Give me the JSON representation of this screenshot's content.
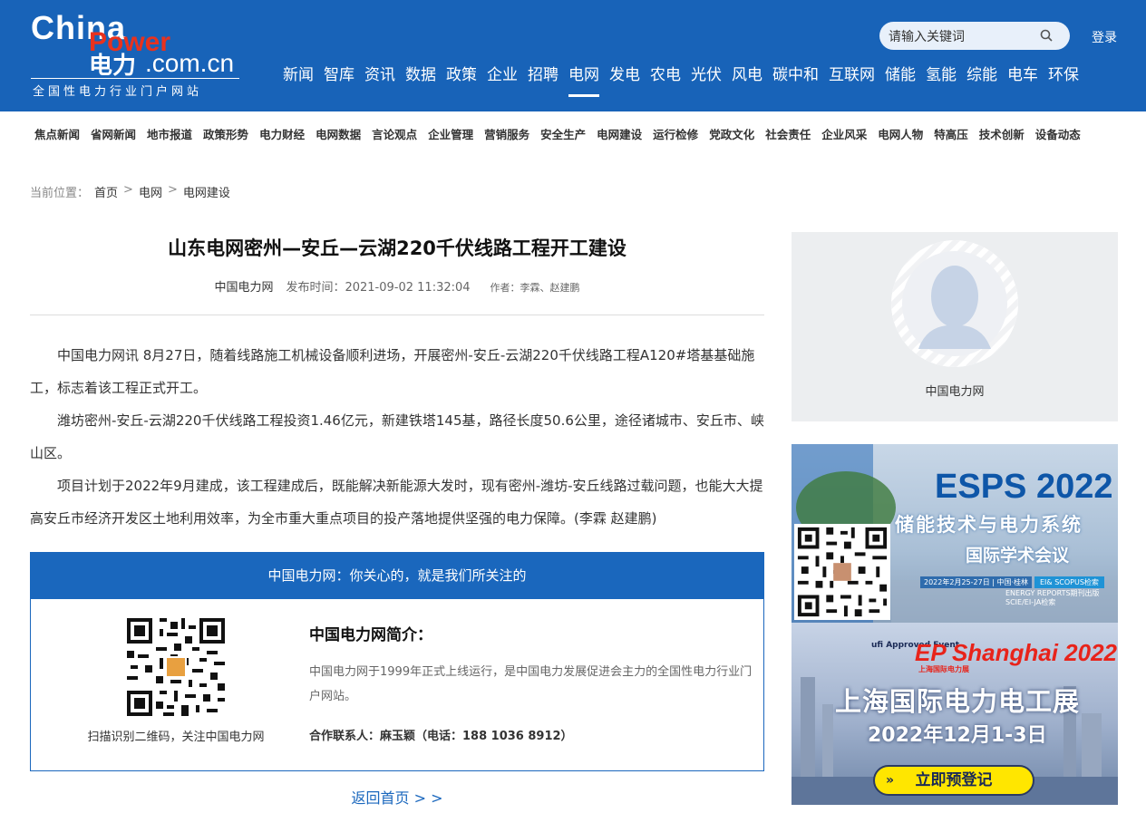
{
  "header": {
    "logo_china": "China",
    "logo_power": "Power",
    "logo_dian": "电力",
    "logo_domain": ".com.cn",
    "logo_sub": "全国性电力行业门户网站",
    "nav": [
      "新闻",
      "智库",
      "资讯",
      "数据",
      "政策",
      "企业",
      "招聘",
      "电网",
      "发电",
      "农电",
      "光伏",
      "风电",
      "碳中和",
      "互联网",
      "储能",
      "氢能",
      "综能",
      "电车",
      "环保"
    ],
    "active_nav": "电网",
    "search_placeholder": "请输入关键词",
    "login": "登录"
  },
  "subnav": [
    "焦点新闻",
    "省网新闻",
    "地市报道",
    "政策形势",
    "电力财经",
    "电网数据",
    "言论观点",
    "企业管理",
    "营销服务",
    "安全生产",
    "电网建设",
    "运行检修",
    "党政文化",
    "社会责任",
    "企业风采",
    "电网人物",
    "特高压",
    "技术创新",
    "设备动态"
  ],
  "breadcrumb": {
    "prefix": "当前位置：",
    "home": "首页",
    "sep1": ">",
    "section": "电网",
    "sep2": ">",
    "current": "电网建设"
  },
  "article": {
    "title": "山东电网密州—安丘—云湖220千伏线路工程开工建设",
    "source": "中国电力网",
    "time": "发布时间：2021-09-02 11:32:04",
    "author": "作者：李霖、赵建鹏",
    "paragraphs": [
      "中国电力网讯  8月27日，随着线路施工机械设备顺利进场，开展密州-安丘-云湖220千伏线路工程A120#塔基基础施工，标志着该工程正式开工。",
      "潍坊密州-安丘-云湖220千伏线路工程投资1.46亿元，新建铁塔145基，路径长度50.6公里，途径诸城市、安丘市、峡山区。",
      "项目计划于2022年9月建成，该工程建成后，既能解决新能源大发时，现有密州-潍坊-安丘线路过载问题，也能大大提高安丘市经济开发区土地利用效率，为全市重大重点项目的投产落地提供坚强的电力保障。(李霖 赵建鹏)"
    ]
  },
  "promo": {
    "header": "中国电力网：你关心的，就是我们所关注的",
    "qr_caption": "扫描识别二维码，关注中国电力网",
    "intro_title": "中国电力网简介：",
    "intro_text": "中国电力网于1999年正式上线运行，是中国电力发展促进会主力的全国性电力行业门户网站。",
    "contact": "合作联系人：麻玉颖（电话：188 1036 8912）"
  },
  "back_link": "返回首页 > >",
  "sidebar": {
    "name": "中国电力网",
    "banner1": {
      "title": "ESPS 2022",
      "sub": "储能技术与电力系统",
      "sub2": "国际学术会议",
      "date": "2022年2月25-27日 | 中国·桂林",
      "tag": "EI& SCOPUS检索",
      "note": "ENERGY REPORTS期刊出版 SCIE/EI-JA检索"
    },
    "banner2": {
      "ufi": "ufi Approved Event",
      "logo": "EP Shanghai 2022",
      "logo_cn": "上海国际电力展",
      "title": "上海国际电力电工展",
      "date": "2022年12月1-3日",
      "button": "立即预登记"
    }
  }
}
